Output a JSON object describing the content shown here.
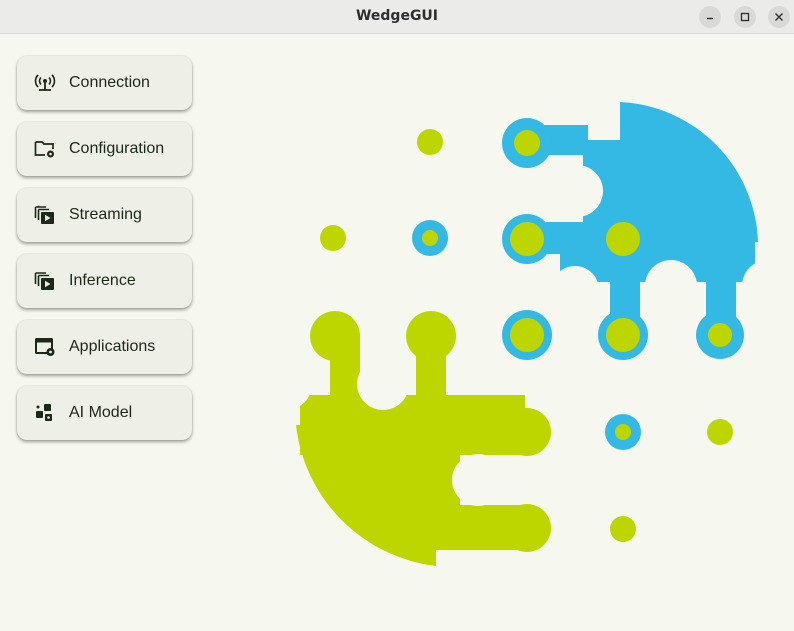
{
  "window": {
    "title": "WedgeGUI",
    "controls": [
      "minimize",
      "maximize",
      "close"
    ]
  },
  "sidebar": {
    "items": [
      {
        "label": "Connection",
        "icon": "antenna-icon"
      },
      {
        "label": "Configuration",
        "icon": "folder-gear-icon"
      },
      {
        "label": "Streaming",
        "icon": "video-library-icon"
      },
      {
        "label": "Inference",
        "icon": "video-library-icon"
      },
      {
        "label": "Applications",
        "icon": "window-gear-icon"
      },
      {
        "label": "AI Model",
        "icon": "model-blocks-icon"
      }
    ]
  },
  "colors": {
    "background": "#f6f8ef",
    "logo_blue": "#33b9e3",
    "logo_green": "#bdd600",
    "button_bg": "#eeefe7",
    "text": "#1d2818"
  }
}
